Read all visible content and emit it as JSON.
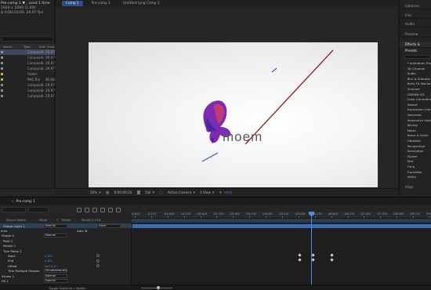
{
  "project": {
    "info_title": "Pre-comp 1 ▼ , used 1 time",
    "info_line1": "1920 x 1080 (1.00)",
    "info_line2": "Δ 0;00;10;00, 29.97 fps",
    "headers": [
      "Name",
      "Type",
      "Size",
      "Frame R..."
    ],
    "items": [
      {
        "name": "",
        "type": "Composition",
        "size": "29.97",
        "selected": true,
        "kind": "comp"
      },
      {
        "name": "",
        "type": "Composition",
        "size": "29.97",
        "selected": false,
        "kind": "comp"
      },
      {
        "name": "",
        "type": "Composition",
        "size": "29.97",
        "selected": false,
        "kind": "comp"
      },
      {
        "name": "",
        "type": "Composition",
        "size": "29.97",
        "selected": false,
        "kind": "comp"
      },
      {
        "name": "",
        "type": "Folder",
        "size": "",
        "selected": false,
        "kind": "folder"
      },
      {
        "name": "",
        "type": "PNG file",
        "size": "40 KB",
        "selected": false,
        "kind": "png"
      },
      {
        "name": "",
        "type": "Composition",
        "size": "29.97",
        "selected": false,
        "kind": "comp"
      },
      {
        "name": "",
        "type": "Composition",
        "size": "29.97",
        "selected": false,
        "kind": "comp"
      },
      {
        "name": "",
        "type": "Composition",
        "size": "29.97",
        "selected": false,
        "kind": "comp"
      }
    ]
  },
  "viewer": {
    "tabs": [
      "Comp 1",
      "Pre-comp 1",
      "Untitled-Lyng Comp 1"
    ],
    "active_tab": 0,
    "logo_text": "moem",
    "bottom_bar": {
      "zoom": "50%",
      "timecode": "0;00;00;24",
      "resolution": "Full",
      "camera": "Active Camera",
      "views": "1 View",
      "exposure": "+0.0"
    }
  },
  "panels": {
    "headers": [
      "Libraries",
      "Info",
      "Audio",
      "Preview",
      "Effects & Presets",
      "Align"
    ],
    "effects": [
      "* Animation Presets",
      "3D Channel",
      "Audio",
      "Blur & Sharpen",
      "Boris FX Mocha",
      "Channel",
      "CINEMA 4D",
      "Color Correction",
      "Distort",
      "Expression Controls",
      "Generate",
      "Immersive Video",
      "Keying",
      "Matte",
      "Noise & Grain",
      "Obsolete",
      "Perspective",
      "Simulation",
      "Stylize",
      "Text",
      "Time",
      "Transition",
      "Utility"
    ]
  },
  "timeline": {
    "tab": "Pre-comp 1",
    "ruler": [
      "0:00f",
      "0:15f",
      "01:00f",
      "01:15f",
      "02:00f",
      "02:15f",
      "03:00f",
      "03:15f",
      "04:00f",
      "04:15f",
      "05:00f",
      "05:15f",
      "06:00f",
      "06:15f",
      "07:00f",
      "07:15f",
      "08:00f",
      "08:15f",
      "09:00f"
    ],
    "columns": [
      "Source Name",
      "Mode",
      "T",
      "TrkMat",
      "Parent & Link"
    ],
    "layers": [
      {
        "label": "Shape Layer 1",
        "mode": "Normal",
        "parent": "None",
        "kind": "layer"
      },
      {
        "label": "ents",
        "kind": "group",
        "extra": "Add: ⊕"
      },
      {
        "label": "Shape 4",
        "mode": "Normal",
        "kind": "prop"
      },
      {
        "label": "Path 1",
        "kind": "prop"
      },
      {
        "label": "Stroke 1",
        "kind": "prop"
      },
      {
        "label": "Trim Paths 1",
        "kind": "prop"
      },
      {
        "label": "Start",
        "value": "0.0%",
        "kind": "value"
      },
      {
        "label": "End",
        "value": "0.0%",
        "kind": "value"
      },
      {
        "label": "Offset",
        "value": "0x+0.0°",
        "kind": "value"
      },
      {
        "label": "Trim Multiple Shapes",
        "mode": "Simultaneously",
        "kind": "prop"
      },
      {
        "label": "Stroke 1",
        "mode": "Normal",
        "kind": "prop"
      },
      {
        "label": "Fill 1",
        "mode": "Normal",
        "kind": "prop"
      }
    ],
    "footer": "Toggle Switches / Modes",
    "current_time": "0;00;05;15"
  },
  "colors": {
    "accent": "#4b8cf0",
    "selection": "#3b4a62",
    "layer_bar": "#3a6bb0",
    "stroke_line": "#8b2b2b",
    "logo_grey": "#5a5a5a"
  }
}
